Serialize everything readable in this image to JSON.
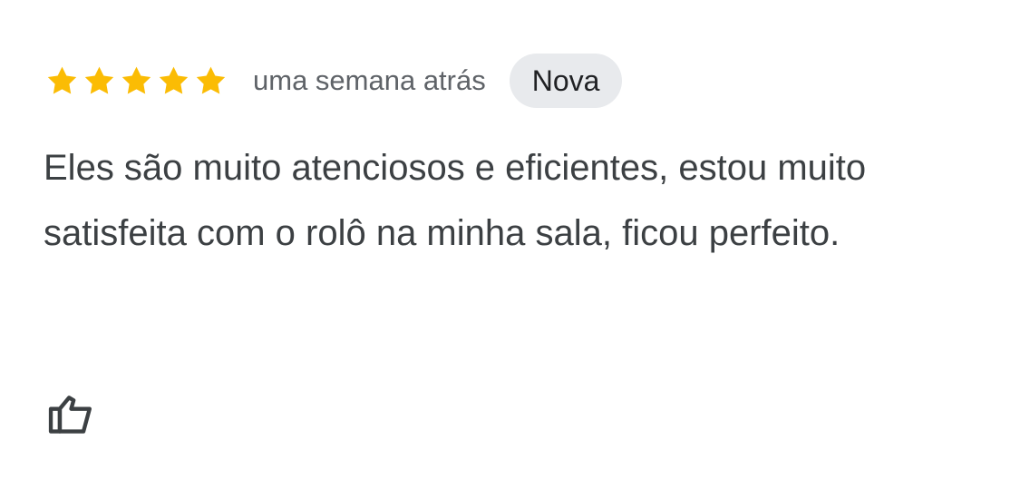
{
  "review": {
    "rating": 5,
    "max_rating": 5,
    "relative_time": "uma semana atrás",
    "badge": "Nova",
    "text": "Eles são muito atenciosos e eficientes, estou muito satisfeita com o rolô na minha sala, ficou perfeito.",
    "star_icon": "star-icon",
    "like_icon": "thumbs-up-icon"
  },
  "colors": {
    "star": "#fbbc04",
    "text": "#3c4043",
    "secondary_text": "#5f6368",
    "badge_background": "#e8eaed",
    "icon": "#3c4043"
  }
}
